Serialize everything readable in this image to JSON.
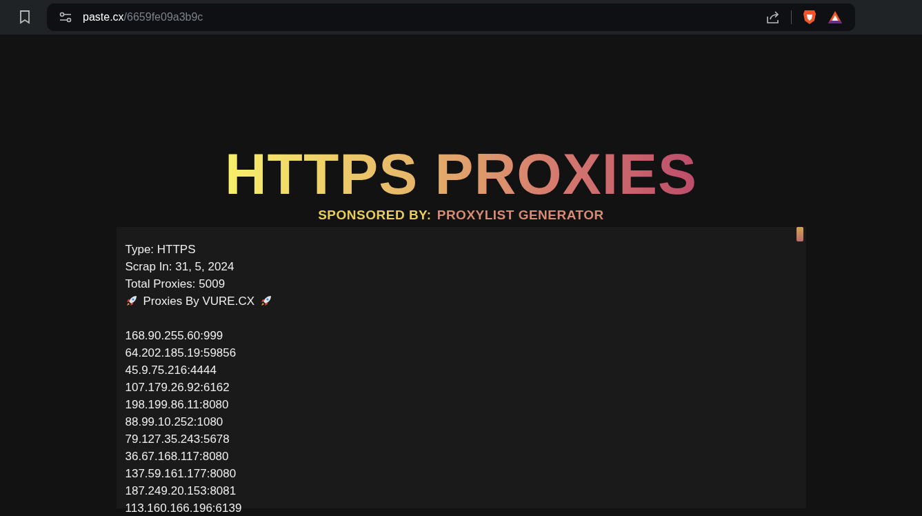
{
  "browser": {
    "url_host": "paste.cx",
    "url_path": "/6659fe09a3b9c"
  },
  "title": "HTTPS PROXIES",
  "sponsor": {
    "label": "SPONSORED BY:",
    "name": "PROXYLIST GENERATOR"
  },
  "paste": {
    "header": [
      {
        "kind": "text",
        "text": "Type: HTTPS"
      },
      {
        "kind": "text",
        "text": "Scrap In: 31, 5, 2024"
      },
      {
        "kind": "text",
        "text": "Total Proxies: 5009"
      },
      {
        "kind": "rocket",
        "text": "Proxies By VURE.CX"
      }
    ],
    "proxies": [
      "168.90.255.60:999",
      "64.202.185.19:59856",
      "45.9.75.216:4444",
      "107.179.26.92:6162",
      "198.199.86.11:8080",
      "88.99.10.252:1080",
      "79.127.35.243:5678",
      "36.67.168.117:8080",
      "137.59.161.177:8080",
      "187.249.20.153:8081",
      "113.160.166.196:6139"
    ]
  }
}
